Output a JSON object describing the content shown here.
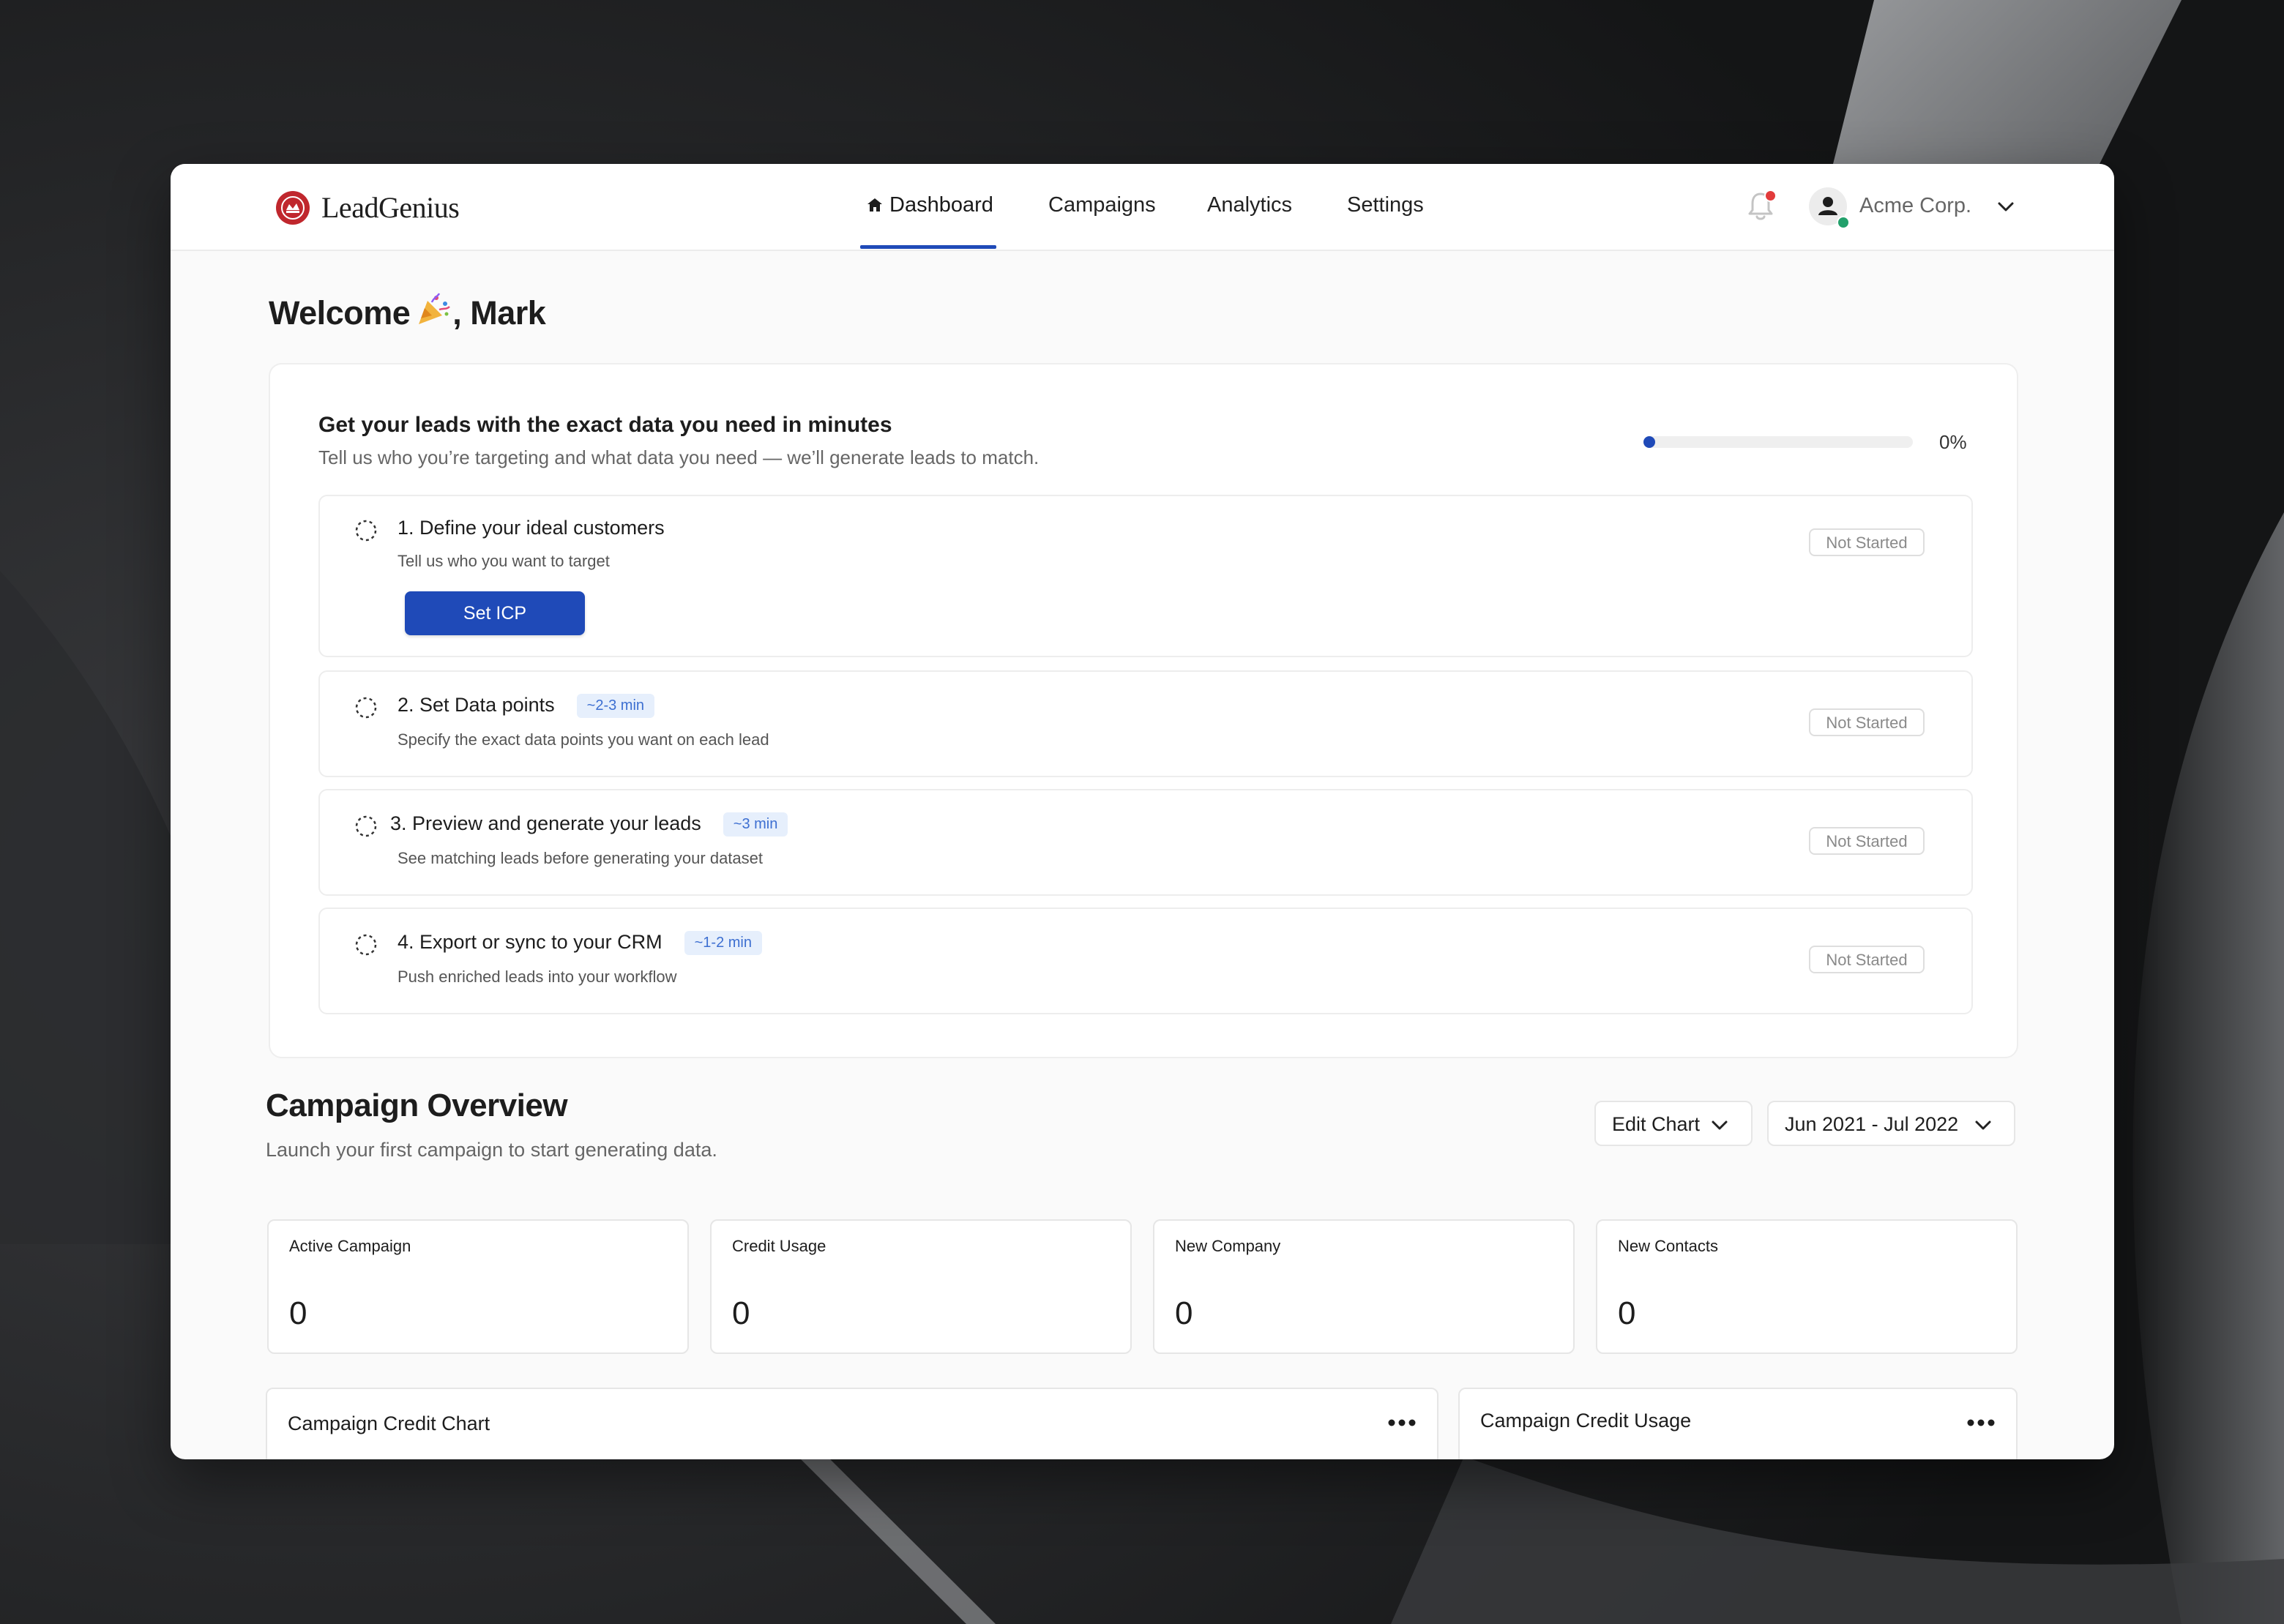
{
  "brand": {
    "name": "LeadGenius"
  },
  "nav": {
    "items": [
      {
        "label": "Dashboard",
        "active": true
      },
      {
        "label": "Campaigns",
        "active": false
      },
      {
        "label": "Analytics",
        "active": false
      },
      {
        "label": "Settings",
        "active": false
      }
    ]
  },
  "account": {
    "org_name": "Acme Corp.",
    "has_notification": true,
    "online": true
  },
  "welcome": {
    "prefix": "Welcome",
    "suffix": ", Mark",
    "emoji": "party-popper"
  },
  "onboarding": {
    "title": "Get your leads with the exact data you need in minutes",
    "subtitle": "Tell us who you’re targeting and what data you need — we’ll generate leads to match.",
    "progress_value": 0,
    "progress_label": "0%",
    "steps": [
      {
        "title": "1. Define your ideal customers",
        "description": "Tell us who you want to target",
        "time": "",
        "status": "Not Started",
        "action_label": "Set ICP"
      },
      {
        "title": "2. Set Data points",
        "description": "Specify the exact data points you want on each lead",
        "time": "~2-3 min",
        "status": "Not Started"
      },
      {
        "title": "3. Preview and generate your leads",
        "description": "See matching leads before generating your dataset",
        "time": "~3 min",
        "status": "Not Started"
      },
      {
        "title": "4. Export or sync to your CRM",
        "description": "Push enriched leads into your workflow",
        "time": "~1-2 min",
        "status": "Not Started"
      }
    ]
  },
  "campaign_overview": {
    "title": "Campaign Overview",
    "subtitle": "Launch your first campaign to start generating data.",
    "edit_chart_label": "Edit Chart",
    "date_range_label": "Jun 2021 - Jul 2022",
    "stats": [
      {
        "label": "Active Campaign",
        "value": "0"
      },
      {
        "label": "Credit Usage",
        "value": "0"
      },
      {
        "label": "New Company",
        "value": "0"
      },
      {
        "label": "New Contacts",
        "value": "0"
      }
    ],
    "panels": [
      {
        "title": "Campaign Credit Chart"
      },
      {
        "title": "Campaign Credit Usage"
      }
    ]
  },
  "colors": {
    "accent": "#1f4ab8",
    "brand_red": "#c0272d",
    "badge_bg": "#e6effc",
    "badge_text": "#3d6fd1",
    "online": "#22a06b",
    "notification": "#e23b3b"
  }
}
